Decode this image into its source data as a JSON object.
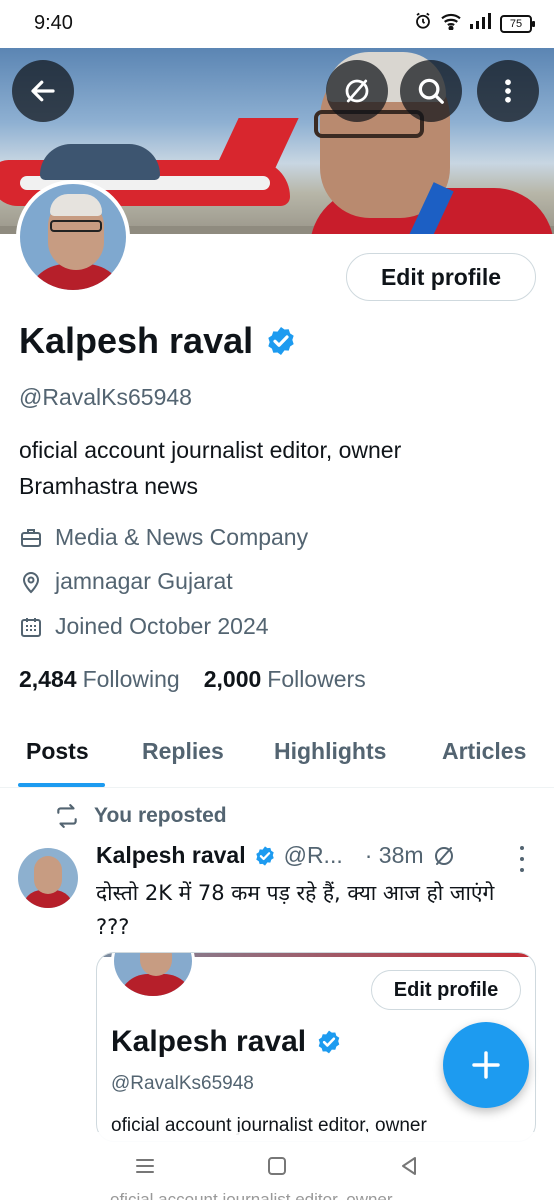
{
  "status_bar": {
    "time": "9:40",
    "battery": "75"
  },
  "header": {
    "icons": [
      "back-arrow-icon",
      "unavailable-circle-icon",
      "search-icon",
      "more-vertical-icon"
    ]
  },
  "profile": {
    "edit_label": "Edit profile",
    "name": "Kalpesh raval",
    "handle": "@RavalKs65948",
    "bio_line1": "oficial account journalist editor, owner",
    "bio_line2": "Bramhastra news",
    "category": "Media & News Company",
    "location": "jamnagar Gujarat",
    "joined": "Joined October 2024",
    "following_count": "2,484",
    "following_label": "Following",
    "followers_count": "2,000",
    "followers_label": "Followers"
  },
  "tabs": [
    {
      "label": "Posts",
      "active": true
    },
    {
      "label": "Replies",
      "active": false
    },
    {
      "label": "Highlights",
      "active": false
    },
    {
      "label": "Articles",
      "active": false
    }
  ],
  "post": {
    "repost_label": "You reposted",
    "author_name": "Kalpesh raval",
    "author_handle": "@R...",
    "time": "· 38m",
    "text": "दोस्तो 2K में 78 कम पड़ रहे हैं, क्या आज हो जाएंगे ???",
    "embed": {
      "edit_label": "Edit profile",
      "name": "Kalpesh raval",
      "handle": "@RavalKs65948",
      "bio": "oficial account journalist editor, owner"
    }
  },
  "nav_ghost_text": "oficial account journalist editor, owner",
  "colors": {
    "accent": "#1d9bf0",
    "text": "#0f1419",
    "muted": "#536471",
    "border": "#cfd9de"
  }
}
